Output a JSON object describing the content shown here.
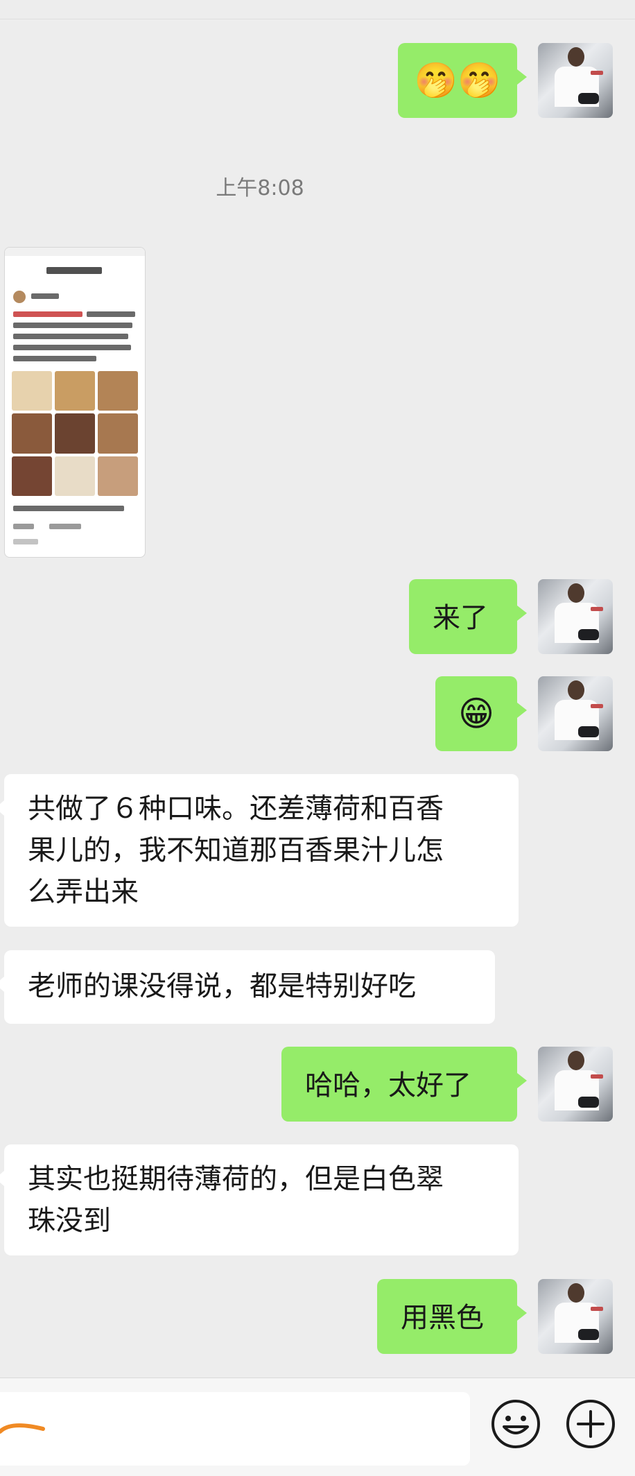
{
  "chat": {
    "timestamp": "上午8:08",
    "messages": [
      {
        "side": "right",
        "kind": "emoji",
        "emoji": "🤭🤭"
      },
      {
        "side": "left",
        "kind": "image",
        "image": "screenshot-thumbnail"
      },
      {
        "side": "right",
        "kind": "text",
        "text": "来了"
      },
      {
        "side": "right",
        "kind": "emoji",
        "emoji": "😁"
      },
      {
        "side": "left",
        "kind": "text",
        "text": "共做了６种口味。还差薄荷和百香\n果儿的，我不知道那百香果汁儿怎\n么弄出来"
      },
      {
        "side": "left",
        "kind": "text",
        "text": "老师的课没得说，都是特别好吃"
      },
      {
        "side": "right",
        "kind": "text",
        "text": "哈哈，太好了"
      },
      {
        "side": "left",
        "kind": "text",
        "text": "其实也挺期待薄荷的，但是白色翠\n珠没到"
      },
      {
        "side": "right",
        "kind": "text",
        "text": "用黑色"
      }
    ]
  },
  "input": {
    "value": ""
  },
  "icons": {
    "emoji": "smiley-face-icon",
    "more": "plus-circle-icon"
  },
  "colors": {
    "background": "#ededed",
    "sent_bubble": "#95ec69",
    "received_bubble": "#ffffff"
  }
}
